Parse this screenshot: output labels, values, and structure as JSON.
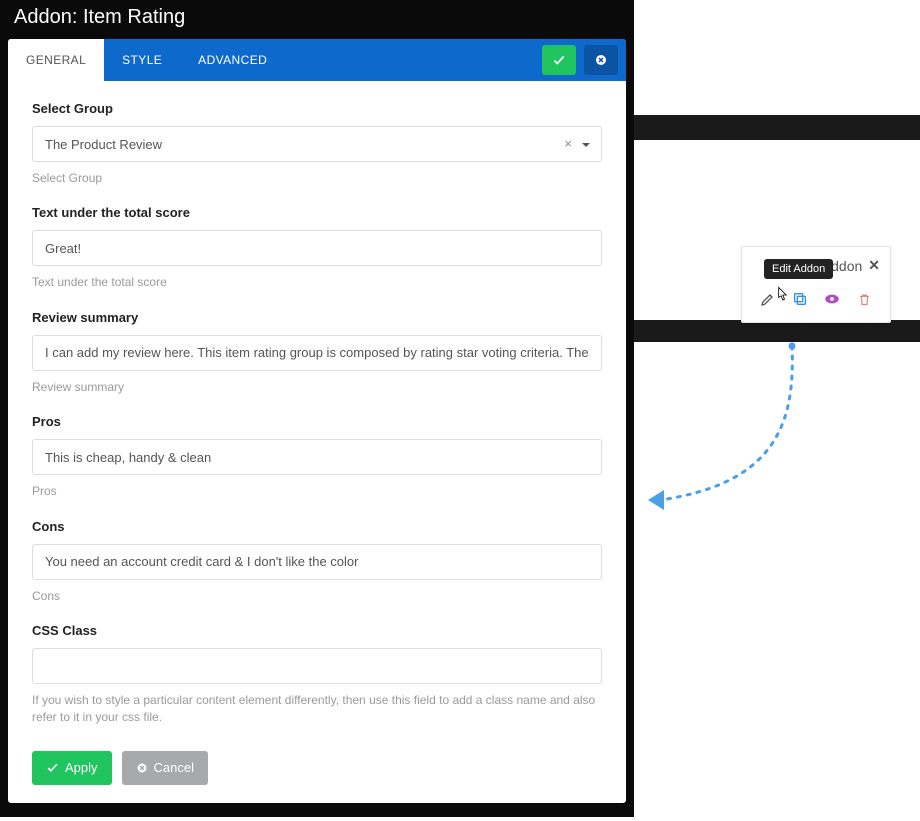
{
  "modal": {
    "title": "Addon: Item Rating",
    "tabs": [
      {
        "label": "GENERAL",
        "active": true
      },
      {
        "label": "STYLE",
        "active": false
      },
      {
        "label": "ADVANCED",
        "active": false
      }
    ],
    "top_buttons": {
      "apply_icon": "check",
      "close_icon": "x"
    },
    "fields": {
      "select_group": {
        "label": "Select Group",
        "value": "The Product Review",
        "help": "Select Group"
      },
      "text_under_total": {
        "label": "Text under the total score",
        "value": "Great!",
        "help": "Text under the total score"
      },
      "review_summary": {
        "label": "Review summary",
        "value": "I can add my review here. This item rating group is composed by rating star voting criteria. The glob",
        "help": "Review summary"
      },
      "pros": {
        "label": "Pros",
        "value": "This is cheap, handy & clean",
        "help": "Pros"
      },
      "cons": {
        "label": "Cons",
        "value": "You need an account credit card & I don't like the color",
        "help": "Cons"
      },
      "css_class": {
        "label": "CSS Class",
        "value": "",
        "help": "If you wish to style a particular content element differently, then use this field to add a class name and also refer to it in your css file."
      }
    },
    "buttons": {
      "apply": "Apply",
      "cancel": "Cancel"
    }
  },
  "popover": {
    "header_text": "Addon",
    "tooltip": "Edit Addon",
    "icons": {
      "edit": "pencil",
      "copy": "copy",
      "visibility": "eye",
      "delete": "trash"
    },
    "colors": {
      "edit": "#555555",
      "copy": "#2f8ee6",
      "visibility": "#b04fb8",
      "delete": "#d98d7a"
    }
  }
}
